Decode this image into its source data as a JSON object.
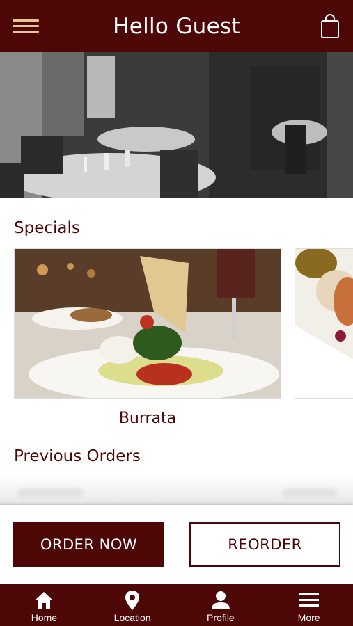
{
  "header": {
    "title": "Hello Guest",
    "menu_icon": "hamburger-menu-icon",
    "cart_icon": "shopping-bag-icon"
  },
  "hero": {
    "image": "restaurant-dining-room-photo"
  },
  "specials": {
    "title": "Specials",
    "items": [
      {
        "name": "Burrata",
        "image": "burrata-dish-photo"
      },
      {
        "name": "",
        "image": "grilled-seafood-dish-photo"
      }
    ]
  },
  "previous_orders": {
    "title": "Previous Orders"
  },
  "actions": {
    "order_now": "ORDER NOW",
    "reorder": "REORDER"
  },
  "bottom_nav": {
    "items": [
      {
        "label": "Home",
        "icon": "home-icon"
      },
      {
        "label": "Location",
        "icon": "location-pin-icon"
      },
      {
        "label": "Profile",
        "icon": "person-icon"
      },
      {
        "label": "More",
        "icon": "hamburger-menu-icon"
      }
    ]
  },
  "colors": {
    "brand": "#4e0707",
    "accent": "#e8c58f",
    "text_on_brand": "#ffffff"
  }
}
